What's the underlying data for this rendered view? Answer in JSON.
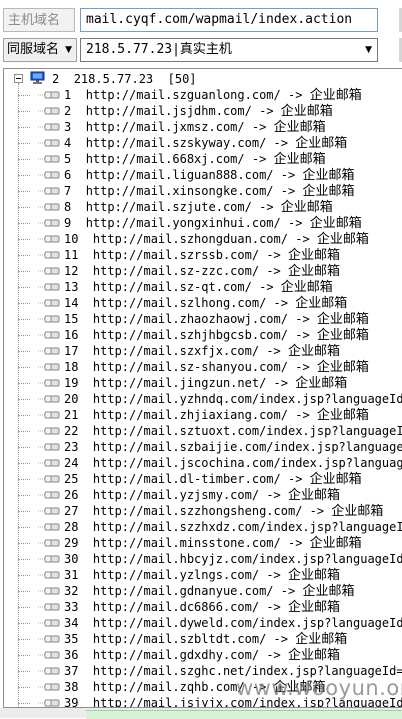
{
  "host_label": "主机域名",
  "host_value": "mail.cyqf.com/wapmail/index.action",
  "mode_label": "同服域名",
  "ip_select": "218.5.77.23|真实主机",
  "tree": {
    "root": {
      "index": "2",
      "ip": "218.5.77.23",
      "count": "[50]"
    },
    "items": [
      {
        "n": "1",
        "url": "http://mail.szguanlong.com/",
        "tail": "企业邮箱"
      },
      {
        "n": "2",
        "url": "http://mail.jsjdhm.com/",
        "tail": "企业邮箱"
      },
      {
        "n": "3",
        "url": "http://mail.jxmsz.com/",
        "tail": "企业邮箱"
      },
      {
        "n": "4",
        "url": "http://mail.szskyway.com/",
        "tail": "企业邮箱"
      },
      {
        "n": "5",
        "url": "http://mail.668xj.com/",
        "tail": "企业邮箱"
      },
      {
        "n": "6",
        "url": "http://mail.liguan888.com/",
        "tail": "企业邮箱"
      },
      {
        "n": "7",
        "url": "http://mail.xinsongke.com/",
        "tail": "企业邮箱"
      },
      {
        "n": "8",
        "url": "http://mail.szjute.com/",
        "tail": "企业邮箱"
      },
      {
        "n": "9",
        "url": "http://mail.yongxinhui.com/",
        "tail": "企业邮箱"
      },
      {
        "n": "10",
        "url": "http://mail.szhongduan.com/",
        "tail": "企业邮箱"
      },
      {
        "n": "11",
        "url": "http://mail.szrssb.com/",
        "tail": "企业邮箱"
      },
      {
        "n": "12",
        "url": "http://mail.sz-zzc.com/",
        "tail": "企业邮箱"
      },
      {
        "n": "13",
        "url": "http://mail.sz-qt.com/",
        "tail": "企业邮箱"
      },
      {
        "n": "14",
        "url": "http://mail.szlhong.com/",
        "tail": "企业邮箱"
      },
      {
        "n": "15",
        "url": "http://mail.zhaozhaowj.com/",
        "tail": "企业邮箱"
      },
      {
        "n": "16",
        "url": "http://mail.szhjhbgcsb.com/",
        "tail": "企业邮箱"
      },
      {
        "n": "17",
        "url": "http://mail.szxfjx.com/",
        "tail": "企业邮箱"
      },
      {
        "n": "18",
        "url": "http://mail.sz-shanyou.com/",
        "tail": "企业邮箱"
      },
      {
        "n": "19",
        "url": "http://mail.jingzun.net/",
        "tail": "企业邮箱"
      },
      {
        "n": "20",
        "url": "http://mail.yzhndq.com/index.jsp?languageId=",
        "tail": ""
      },
      {
        "n": "21",
        "url": "http://mail.zhjiaxiang.com/",
        "tail": "企业邮箱"
      },
      {
        "n": "22",
        "url": "http://mail.sztuoxt.com/index.jsp?languageId",
        "tail": ""
      },
      {
        "n": "23",
        "url": "http://mail.szbaijie.com/index.jsp?languageI",
        "tail": ""
      },
      {
        "n": "24",
        "url": "http://mail.jscochina.com/index.jsp?language",
        "tail": ""
      },
      {
        "n": "25",
        "url": "http://mail.dl-timber.com/",
        "tail": "企业邮箱"
      },
      {
        "n": "26",
        "url": "http://mail.yzjsmy.com/",
        "tail": "企业邮箱"
      },
      {
        "n": "27",
        "url": "http://mail.szzhongsheng.com/",
        "tail": "企业邮箱"
      },
      {
        "n": "28",
        "url": "http://mail.szzhxdz.com/index.jsp?languageId",
        "tail": ""
      },
      {
        "n": "29",
        "url": "http://mail.minsstone.com/",
        "tail": "企业邮箱"
      },
      {
        "n": "30",
        "url": "http://mail.hbcyjz.com/index.jsp?languageId=",
        "tail": ""
      },
      {
        "n": "31",
        "url": "http://mail.yzlngs.com/",
        "tail": "企业邮箱"
      },
      {
        "n": "32",
        "url": "http://mail.gdnanyue.com/",
        "tail": "企业邮箱"
      },
      {
        "n": "33",
        "url": "http://mail.dc6866.com/",
        "tail": "企业邮箱"
      },
      {
        "n": "34",
        "url": "http://mail.dyweld.com/index.jsp?languageId=",
        "tail": ""
      },
      {
        "n": "35",
        "url": "http://mail.szbltdt.com/",
        "tail": "企业邮箱"
      },
      {
        "n": "36",
        "url": "http://mail.gdxdhy.com/",
        "tail": "企业邮箱"
      },
      {
        "n": "37",
        "url": "http://mail.szghc.net/index.jsp?languageId=",
        "tail": ""
      },
      {
        "n": "38",
        "url": "http://mail.zqhb.com/",
        "tail": "企业邮箱"
      },
      {
        "n": "39",
        "url": "http://mail.jsjyjx.com/index.jsp?languageId=",
        "tail": ""
      }
    ]
  },
  "arrow": "->",
  "watermark": "www.wooyun.org"
}
